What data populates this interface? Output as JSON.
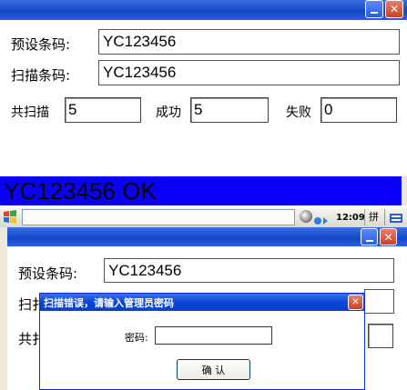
{
  "top_window": {
    "preset_label": "预设条码:",
    "preset_value": "YC123456",
    "scan_label": "扫描条码:",
    "scan_value": "YC123456",
    "total_label": "共扫描",
    "total_value": "5",
    "success_label": "成功",
    "success_value": "5",
    "fail_label": "失败",
    "fail_value": "0",
    "status_banner": "YC123456   OK"
  },
  "taskbar": {
    "time": "12:09",
    "ime": "拼"
  },
  "bottom_window": {
    "preset_label": "预设条码:",
    "preset_value": "YC123456",
    "scan_label_partial": "扫扌",
    "total_label_partial": "共扌"
  },
  "dialog": {
    "title": "扫描错误，请输入管理员密码",
    "password_label": "密码:",
    "password_value": "",
    "ok_label": "确 认"
  },
  "colors": {
    "banner_bg": "#0a00f8",
    "titlebar": "#1a4fd0"
  }
}
